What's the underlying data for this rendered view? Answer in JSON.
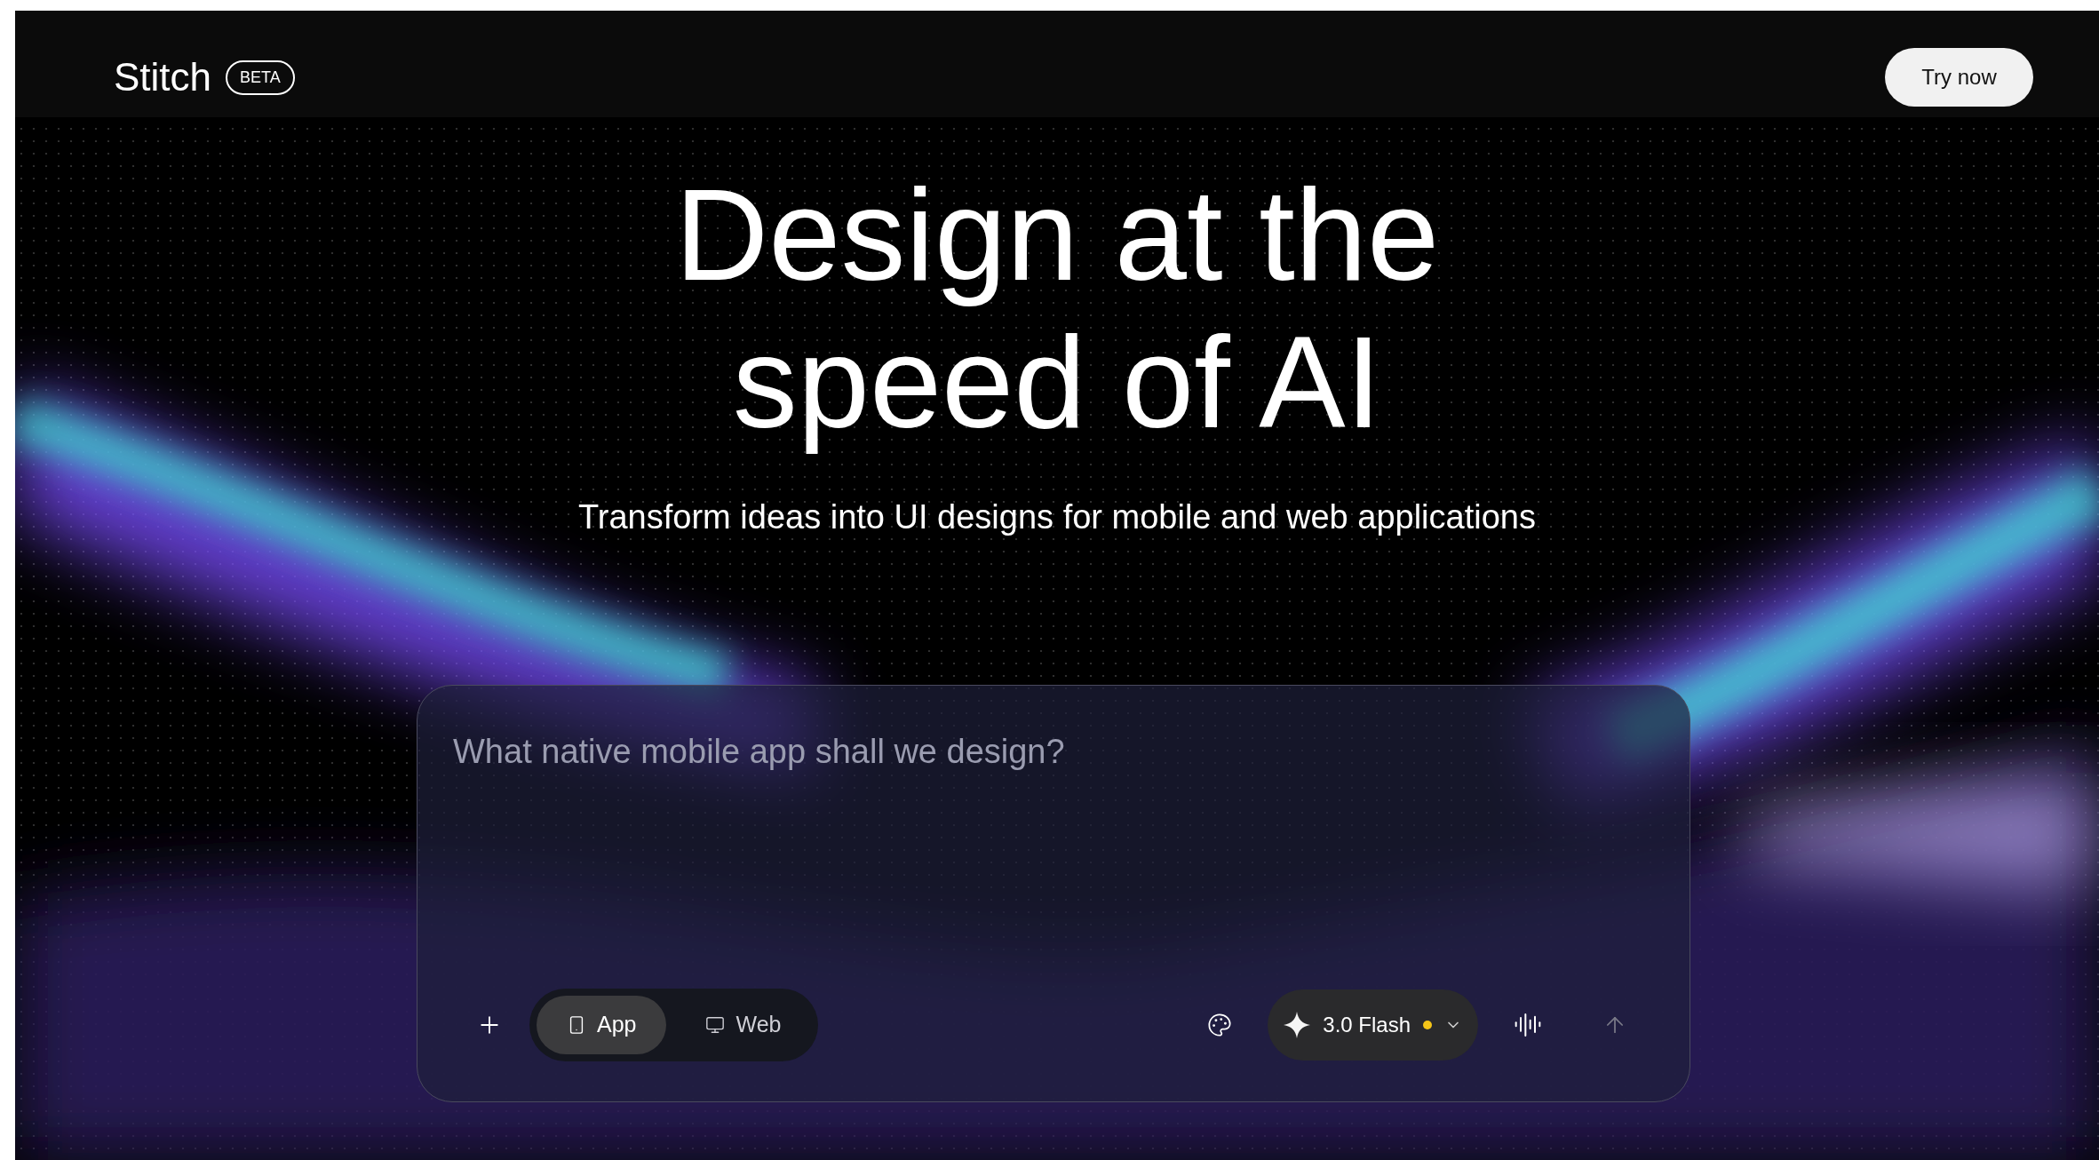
{
  "header": {
    "logo": "Stitch",
    "badge": "BETA",
    "cta": "Try now"
  },
  "hero": {
    "title_lines": [
      "Design at the",
      "speed of AI"
    ],
    "subtitle": "Transform ideas into UI designs for mobile and web applications"
  },
  "prompt": {
    "placeholder": "What native mobile app shall we design?",
    "modes": [
      {
        "label": "App",
        "kind": "phone",
        "selected": true
      },
      {
        "label": "Web",
        "kind": "desktop",
        "selected": false
      }
    ],
    "model": "3.0 Flash"
  }
}
